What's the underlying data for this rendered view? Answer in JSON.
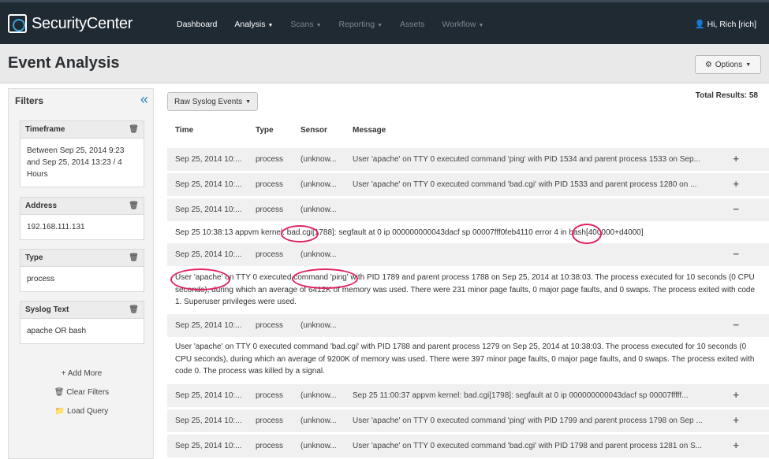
{
  "app": {
    "name": "SecurityCenter"
  },
  "nav": [
    {
      "label": "Dashboard",
      "caret": false,
      "dim": false
    },
    {
      "label": "Analysis",
      "caret": true,
      "dim": false
    },
    {
      "label": "Scans",
      "caret": true,
      "dim": true
    },
    {
      "label": "Reporting",
      "caret": true,
      "dim": true
    },
    {
      "label": "Assets",
      "caret": false,
      "dim": true
    },
    {
      "label": "Workflow",
      "caret": true,
      "dim": true
    }
  ],
  "user": {
    "greeting": "Hi, Rich [rich]"
  },
  "page": {
    "title": "Event Analysis",
    "options_label": "Options"
  },
  "sidebar": {
    "title": "Filters",
    "filters": [
      {
        "name": "Timeframe",
        "value": "Between Sep 25, 2014 9:23 and Sep 25, 2014 13:23 / 4 Hours"
      },
      {
        "name": "Address",
        "value": "192.168.111.131"
      },
      {
        "name": "Type",
        "value": "process"
      },
      {
        "name": "Syslog Text",
        "value": "apache OR bash"
      }
    ],
    "add_more": "Add More",
    "clear_filters": "Clear Filters",
    "load_query": "Load Query"
  },
  "main": {
    "view_button": "Raw Syslog Events",
    "total_results": "Total Results: 58",
    "columns": [
      "Time",
      "Type",
      "Sensor",
      "Message"
    ],
    "rows": [
      {
        "time": "Sep 25, 2014 10:...",
        "type": "process",
        "sensor": "(unknow...",
        "message": "User 'apache' on TTY 0 executed command 'ping' with PID 1534 and parent process 1533 on Sep...",
        "toggle": "+"
      },
      {
        "time": "Sep 25, 2014 10:...",
        "type": "process",
        "sensor": "(unknow...",
        "message": "User 'apache' on TTY 0 executed command 'bad.cgi' with PID 1533 and parent process 1280 on ...",
        "toggle": "+"
      },
      {
        "time": "Sep 25, 2014 10:...",
        "type": "process",
        "sensor": "(unknow...",
        "message": "",
        "toggle": "−"
      },
      {
        "time": "Sep 25, 2014 10:...",
        "type": "process",
        "sensor": "(unknow...",
        "message": "",
        "toggle": "−"
      },
      {
        "time": "Sep 25, 2014 10:...",
        "type": "process",
        "sensor": "(unknow...",
        "message": "",
        "toggle": "−"
      },
      {
        "time": "Sep 25, 2014 10:...",
        "type": "process",
        "sensor": "(unknow...",
        "message": "Sep 25 11:00:37 appvm kernel: bad.cgi[1798]: segfault at 0 ip 000000000043dacf sp 00007fffff...",
        "toggle": "+"
      },
      {
        "time": "Sep 25, 2014 10:...",
        "type": "process",
        "sensor": "(unknow...",
        "message": "User 'apache' on TTY 0 executed command 'ping' with PID 1799 and parent process 1798 on Sep ...",
        "toggle": "+"
      },
      {
        "time": "Sep 25, 2014 10:...",
        "type": "process",
        "sensor": "(unknow...",
        "message": "User 'apache' on TTY 0 executed command 'bad.cgi' with PID 1798 and parent process 1281 on S...",
        "toggle": "+"
      }
    ],
    "details": [
      "Sep 25 10:38:13 appvm kernel: bad.cgi[1788]: segfault at 0 ip 000000000043dacf sp 00007fff0feb4110 error 4 in bash[400000+d4000]",
      "User 'apache' on TTY 0 executed command 'ping' with PID 1789 and parent process 1788 on Sep 25, 2014 at 10:38:03. The process executed for 10 seconds (0 CPU seconds), during which an average of 6412K of memory was used. There were 231 minor page faults, 0 major page faults, and 0 swaps. The process exited with code 1. Superuser privileges were used.",
      "User 'apache' on TTY 0 executed command 'bad.cgi' with PID 1788 and parent process 1279 on Sep 25, 2014 at 10:38:03. The process executed for 10 seconds (0 CPU seconds), during which an average of 9200K of memory was used. There were 397 minor page faults, 0 major page faults, and 0 swaps. The process exited with code 0. The process was killed by a signal."
    ]
  },
  "colors": {
    "nav_bg": "#1f2a33",
    "accent": "#2f7db8",
    "highlight": "#e0245e"
  }
}
